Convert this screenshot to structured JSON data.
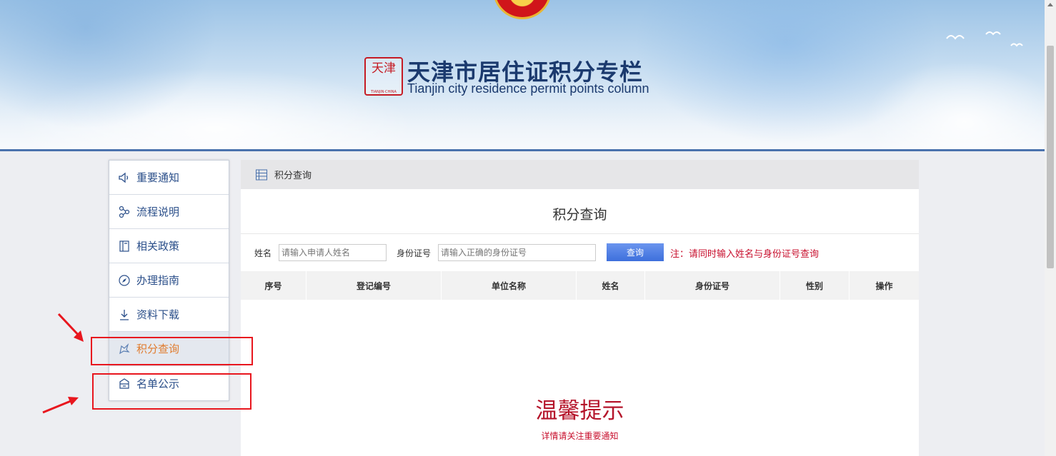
{
  "banner": {
    "title": "天津市居住证积分专栏",
    "subtitle": "Tianjin city residence permit points column",
    "seal_text": "天津",
    "seal_sub": "TIANJIN·CHINA"
  },
  "sidebar": {
    "items": [
      {
        "label": "重要通知",
        "icon": "speaker-icon"
      },
      {
        "label": "流程说明",
        "icon": "flow-icon"
      },
      {
        "label": "相关政策",
        "icon": "book-icon"
      },
      {
        "label": "办理指南",
        "icon": "compass-icon"
      },
      {
        "label": "资料下载",
        "icon": "download-icon"
      },
      {
        "label": "积分查询",
        "icon": "points-icon",
        "active": true
      },
      {
        "label": "名单公示",
        "icon": "building-icon"
      }
    ]
  },
  "main": {
    "breadcrumb": "积分查询",
    "title": "积分查询",
    "form": {
      "name_label": "姓名",
      "name_placeholder": "请输入申请人姓名",
      "id_label": "身份证号",
      "id_placeholder": "请输入正确的身份证号",
      "query_button": "查询",
      "note": "注：请同时输入姓名与身份证号查询"
    },
    "table": {
      "headers": [
        "序号",
        "登记编号",
        "单位名称",
        "姓名",
        "身份证号",
        "性别",
        "操作"
      ]
    },
    "tip": {
      "title": "温馨提示",
      "subtitle": "详情请关注重要通知"
    }
  },
  "colors": {
    "accent": "#2b4f8a",
    "active": "#e07b2d",
    "alert": "#c8102e",
    "annotation": "#e8161e"
  }
}
